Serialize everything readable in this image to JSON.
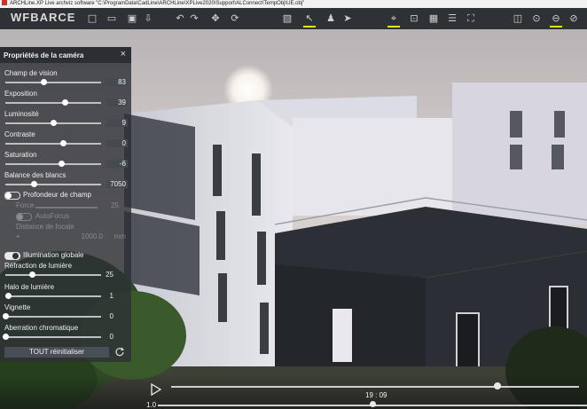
{
  "window": {
    "title": "ARCHLine.XP Live archviz software  \"C:\\ProgramData\\CadLine\\ARCHLine\\XPLive2020\\Support\\ALConnect\\TempObj\\UE.obj\""
  },
  "app": {
    "logo_text": "WFBARCE"
  },
  "toolbar": {
    "icons": [
      "new-icon",
      "open-icon",
      "save-icon",
      "export-icon",
      "undo-icon",
      "redo-icon",
      "move-icon",
      "rotate-icon",
      "scale-icon",
      "select-icon",
      "walk-icon",
      "fly-icon",
      "pin-icon",
      "screenshot-icon",
      "grid-icon",
      "layers-icon",
      "materials-icon",
      "objects-icon",
      "camera-icon",
      "sun-icon",
      "paint-icon",
      "settings-icon"
    ],
    "accent_color": "#e6e600"
  },
  "camera_panel": {
    "title": "Propriétés de la caméra",
    "close_glyph": "×",
    "props": [
      {
        "label": "Champ de vision",
        "value": "83",
        "level": 0.4
      },
      {
        "label": "Exposition",
        "value": "39",
        "level": 0.62
      },
      {
        "label": "Luminosité",
        "value": "9",
        "level": 0.5
      },
      {
        "label": "Contraste",
        "value": "0",
        "level": 0.6
      },
      {
        "label": "Saturation",
        "value": "-6",
        "level": 0.58
      },
      {
        "label": "Balance des blancs",
        "value": "7050",
        "level": 0.3
      }
    ],
    "dof": {
      "label": "Profondeur de champ",
      "force_label": "Force",
      "force_value": "25",
      "autofocus_label": "AutoFocus",
      "focal_label": "Distance de focale",
      "focal_value": "1000.0",
      "focal_unit": "mm"
    },
    "gi_label": "Illumination globale",
    "refraction": {
      "label": "Réfraction de lumière",
      "value": "25",
      "level": 0.28
    },
    "halo": {
      "label": "Halo de lumière",
      "value": "1",
      "level": 0.03
    },
    "vignette": {
      "label": "Vignette",
      "value": "0",
      "level": 0.0
    },
    "chromatic": {
      "label": "Aberration chromatique",
      "value": "0",
      "level": 0.0
    },
    "reset_label": "TOUT réinitialiser"
  },
  "timeline": {
    "time": "19 : 09",
    "speed": "1.0",
    "time_level": 0.8,
    "speed_level": 0.5
  }
}
